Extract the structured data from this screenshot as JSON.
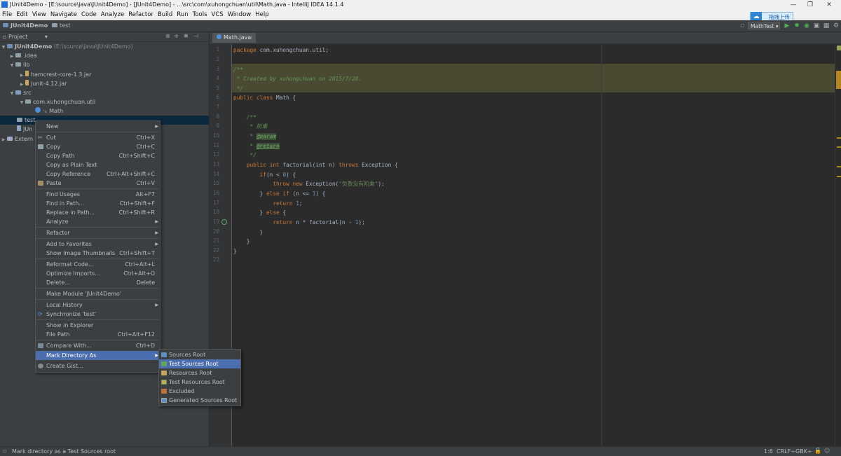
{
  "window": {
    "title": "JUnit4Demo - [E:\\source\\java\\JUnit4Demo] - [JUnit4Demo] - ...\\src\\com\\xuhongchuan\\util\\Math.java - IntelliJ IDEA 14.1.4",
    "minimize": "—",
    "maximize": "❐",
    "close": "✕",
    "upload_badge": "拖拽上传"
  },
  "menubar": [
    "File",
    "Edit",
    "View",
    "Navigate",
    "Code",
    "Analyze",
    "Refactor",
    "Build",
    "Run",
    "Tools",
    "VCS",
    "Window",
    "Help"
  ],
  "navbar": {
    "crumb_project": "JUnit4Demo",
    "crumb_folder": "test",
    "run_config": "MathTest"
  },
  "project_panel": {
    "header": "Project",
    "tree": [
      {
        "label": "JUnit4Demo",
        "extra": " (E:\\source\\java\\JUnit4Demo)",
        "depth": 0,
        "open": true
      },
      {
        "label": ".idea",
        "depth": 1,
        "open": false
      },
      {
        "label": "lib",
        "depth": 1,
        "open": true
      },
      {
        "label": "hamcrest-core-1.3.jar",
        "depth": 2,
        "open": false
      },
      {
        "label": "junit-4.12.jar",
        "depth": 2,
        "open": false
      },
      {
        "label": "src",
        "depth": 1,
        "open": true
      },
      {
        "label": "com.xuhongchuan.util",
        "depth": 2,
        "open": true
      },
      {
        "label": "Math",
        "depth": 3,
        "leaf": true
      },
      {
        "label": "test",
        "depth": 1,
        "leaf": true,
        "selected": true
      },
      {
        "label": "JUn",
        "depth": 1,
        "leaf": true
      },
      {
        "label": "Extern",
        "depth": 0,
        "open": false
      }
    ]
  },
  "editor": {
    "tab": "Math.java",
    "lines": [
      "1",
      "2",
      "3",
      "4",
      "5",
      "6",
      "7",
      "8",
      "9",
      "10",
      "11",
      "12",
      "13",
      "14",
      "15",
      "16",
      "17",
      "18",
      "19",
      "20",
      "21",
      "22",
      "23"
    ]
  },
  "code": {
    "l1_kw": "package",
    "l1_rest": " com.xuhongchuan.util;",
    "l3": "/**",
    "l4": " * Created by xuhongchuan on 2015/7/28.",
    "l5": " */",
    "l6_kw": "public class",
    "l6_rest": " Math {",
    "l8": "    /**",
    "l9": "     * 阶乘",
    "l10_pre": "     * ",
    "l10_tag": "@param",
    "l11_pre": "     * ",
    "l11_tag": "@return",
    "l12": "     */",
    "l13_kw": "    public int",
    "l13_rest": " factorial(int n) ",
    "l13_kw2": "throws",
    "l13_rest2": " Exception {",
    "l14_kw": "        if",
    "l14_rest": "(n < ",
    "l14_num": "0",
    "l14_end": ") {",
    "l15_kw": "            throw new",
    "l15_rest": " Exception(",
    "l15_str": "\"负数没有阶乘\"",
    "l15_end": ");",
    "l16_a": "        } ",
    "l16_kw": "else if",
    "l16_b": " (n <= ",
    "l16_num": "1",
    "l16_c": ") {",
    "l17_kw": "            return",
    "l17_num": " 1",
    "l17_end": ";",
    "l18_a": "        } ",
    "l18_kw": "else",
    "l18_b": " {",
    "l19_kw": "            return",
    "l19_rest": " n * factorial(n - ",
    "l19_num": "1",
    "l19_end": ");",
    "l20": "        }",
    "l21": "    }",
    "l22": "}"
  },
  "context_menu": {
    "new": "New",
    "cut": "Cut",
    "cut_sc": "Ctrl+X",
    "copy": "Copy",
    "copy_sc": "Ctrl+C",
    "copy_path": "Copy Path",
    "copy_path_sc": "Ctrl+Shift+C",
    "copy_plain": "Copy as Plain Text",
    "copy_ref": "Copy Reference",
    "copy_ref_sc": "Ctrl+Alt+Shift+C",
    "paste": "Paste",
    "paste_sc": "Ctrl+V",
    "find_usages": "Find Usages",
    "find_usages_sc": "Alt+F7",
    "find_in_path": "Find in Path...",
    "find_in_path_sc": "Ctrl+Shift+F",
    "replace_in_path": "Replace in Path...",
    "replace_in_path_sc": "Ctrl+Shift+R",
    "analyze": "Analyze",
    "refactor": "Refactor",
    "add_fav": "Add to Favorites",
    "show_thumbs": "Show Image Thumbnails",
    "show_thumbs_sc": "Ctrl+Shift+T",
    "reformat": "Reformat Code...",
    "reformat_sc": "Ctrl+Alt+L",
    "optimize": "Optimize Imports...",
    "optimize_sc": "Ctrl+Alt+O",
    "delete": "Delete...",
    "delete_sc": "Delete",
    "make_module": "Make Module 'JUnit4Demo'",
    "local_history": "Local History",
    "synchronize": "Synchronize 'test'",
    "show_explorer": "Show in Explorer",
    "file_path": "File Path",
    "file_path_sc": "Ctrl+Alt+F12",
    "compare": "Compare With...",
    "compare_sc": "Ctrl+D",
    "mark_dir": "Mark Directory As",
    "create_gist": "Create Gist..."
  },
  "submenu": {
    "sources_root": "Sources Root",
    "test_sources_root": "Test Sources Root",
    "resources_root": "Resources Root",
    "test_resources_root": "Test Resources Root",
    "excluded": "Excluded",
    "generated_sources_root": "Generated Sources Root"
  },
  "statusbar": {
    "message": "Mark directory as a Test Sources root",
    "position": "1:6",
    "line_sep": "CRLF÷",
    "encoding": "GBK÷"
  },
  "colors": {
    "accent": "#4b6eaf",
    "background": "#2b2b2b",
    "panel": "#3c3f41"
  }
}
